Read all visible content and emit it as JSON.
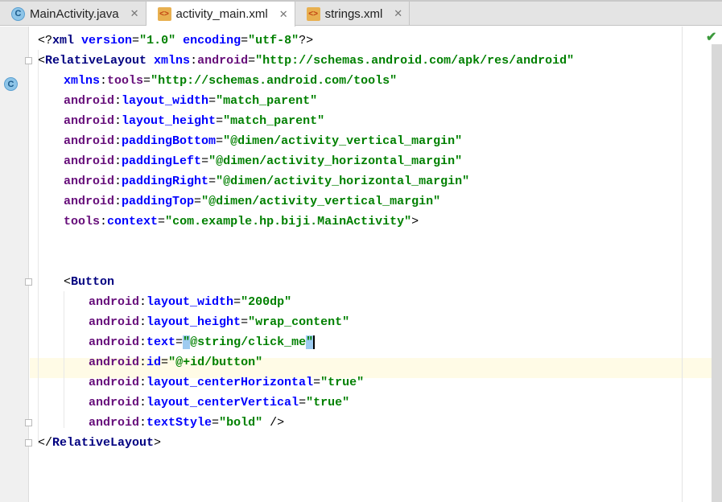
{
  "tabs": [
    {
      "label": "MainActivity.java",
      "icon": "java-class-icon",
      "active": false
    },
    {
      "label": "activity_main.xml",
      "icon": "xml-file-icon",
      "active": true
    },
    {
      "label": "strings.xml",
      "icon": "xml-file-icon",
      "active": false
    }
  ],
  "close_glyph": "✕",
  "status_icon": "✔",
  "lines": [
    {
      "indent": 0,
      "tokens": [
        [
          "pun",
          "<?"
        ],
        [
          "tag",
          "xml "
        ],
        [
          "attr",
          "version"
        ],
        [
          "pun",
          "="
        ],
        [
          "val",
          "\"1.0\" "
        ],
        [
          "attr",
          "encoding"
        ],
        [
          "pun",
          "="
        ],
        [
          "val",
          "\"utf-8\""
        ],
        [
          "pun",
          "?>"
        ]
      ]
    },
    {
      "indent": 0,
      "tokens": [
        [
          "pun",
          "<"
        ],
        [
          "tag",
          "RelativeLayout "
        ],
        [
          "attr",
          "xmlns"
        ],
        [
          "pun",
          ":"
        ],
        [
          "ns",
          "android"
        ],
        [
          "pun",
          "="
        ],
        [
          "val",
          "\"http://schemas.android.com/apk/res/android\""
        ]
      ]
    },
    {
      "indent": 1,
      "tokens": [
        [
          "attr",
          "xmlns"
        ],
        [
          "pun",
          ":"
        ],
        [
          "ns",
          "tools"
        ],
        [
          "pun",
          "="
        ],
        [
          "val",
          "\"http://schemas.android.com/tools\""
        ]
      ]
    },
    {
      "indent": 1,
      "tokens": [
        [
          "ns",
          "android"
        ],
        [
          "pun",
          ":"
        ],
        [
          "attr",
          "layout_width"
        ],
        [
          "pun",
          "="
        ],
        [
          "val",
          "\"match_parent\""
        ]
      ]
    },
    {
      "indent": 1,
      "tokens": [
        [
          "ns",
          "android"
        ],
        [
          "pun",
          ":"
        ],
        [
          "attr",
          "layout_height"
        ],
        [
          "pun",
          "="
        ],
        [
          "val",
          "\"match_parent\""
        ]
      ]
    },
    {
      "indent": 1,
      "tokens": [
        [
          "ns",
          "android"
        ],
        [
          "pun",
          ":"
        ],
        [
          "attr",
          "paddingBottom"
        ],
        [
          "pun",
          "="
        ],
        [
          "val",
          "\"@dimen/activity_vertical_margin\""
        ]
      ]
    },
    {
      "indent": 1,
      "tokens": [
        [
          "ns",
          "android"
        ],
        [
          "pun",
          ":"
        ],
        [
          "attr",
          "paddingLeft"
        ],
        [
          "pun",
          "="
        ],
        [
          "val",
          "\"@dimen/activity_horizontal_margin\""
        ]
      ]
    },
    {
      "indent": 1,
      "tokens": [
        [
          "ns",
          "android"
        ],
        [
          "pun",
          ":"
        ],
        [
          "attr",
          "paddingRight"
        ],
        [
          "pun",
          "="
        ],
        [
          "val",
          "\"@dimen/activity_horizontal_margin\""
        ]
      ]
    },
    {
      "indent": 1,
      "tokens": [
        [
          "ns",
          "android"
        ],
        [
          "pun",
          ":"
        ],
        [
          "attr",
          "paddingTop"
        ],
        [
          "pun",
          "="
        ],
        [
          "val",
          "\"@dimen/activity_vertical_margin\""
        ]
      ]
    },
    {
      "indent": 1,
      "tokens": [
        [
          "ns",
          "tools"
        ],
        [
          "pun",
          ":"
        ],
        [
          "attr",
          "context"
        ],
        [
          "pun",
          "="
        ],
        [
          "val",
          "\"com.example.hp.biji.MainActivity\""
        ],
        [
          "pun",
          ">"
        ]
      ]
    },
    {
      "indent": 0,
      "tokens": []
    },
    {
      "indent": 0,
      "tokens": []
    },
    {
      "indent": 1,
      "tokens": [
        [
          "pun",
          "<"
        ],
        [
          "tag",
          "Button"
        ]
      ]
    },
    {
      "indent": 2,
      "tokens": [
        [
          "ns",
          "android"
        ],
        [
          "pun",
          ":"
        ],
        [
          "attr",
          "layout_width"
        ],
        [
          "pun",
          "="
        ],
        [
          "val",
          "\"200dp\""
        ]
      ]
    },
    {
      "indent": 2,
      "tokens": [
        [
          "ns",
          "android"
        ],
        [
          "pun",
          ":"
        ],
        [
          "attr",
          "layout_height"
        ],
        [
          "pun",
          "="
        ],
        [
          "val",
          "\"wrap_content\""
        ]
      ]
    },
    {
      "indent": 2,
      "tokens": [
        [
          "ns",
          "android"
        ],
        [
          "pun",
          ":"
        ],
        [
          "attr",
          "text"
        ],
        [
          "pun",
          "="
        ],
        [
          "val hl",
          "\""
        ],
        [
          "val",
          "@string/click_me"
        ],
        [
          "val hl",
          "\""
        ]
      ]
    },
    {
      "indent": 2,
      "tokens": [
        [
          "ns",
          "android"
        ],
        [
          "pun",
          ":"
        ],
        [
          "attr",
          "id"
        ],
        [
          "pun",
          "="
        ],
        [
          "val",
          "\"@+id/button\""
        ]
      ]
    },
    {
      "indent": 2,
      "tokens": [
        [
          "ns",
          "android"
        ],
        [
          "pun",
          ":"
        ],
        [
          "attr",
          "layout_centerHorizontal"
        ],
        [
          "pun",
          "="
        ],
        [
          "val",
          "\"true\""
        ]
      ]
    },
    {
      "indent": 2,
      "tokens": [
        [
          "ns",
          "android"
        ],
        [
          "pun",
          ":"
        ],
        [
          "attr",
          "layout_centerVertical"
        ],
        [
          "pun",
          "="
        ],
        [
          "val",
          "\"true\""
        ]
      ]
    },
    {
      "indent": 2,
      "tokens": [
        [
          "ns",
          "android"
        ],
        [
          "pun",
          ":"
        ],
        [
          "attr",
          "textStyle"
        ],
        [
          "pun",
          "="
        ],
        [
          "val",
          "\"bold\" "
        ],
        [
          "pun",
          "/>"
        ]
      ]
    },
    {
      "indent": 0,
      "tokens": [
        [
          "pun",
          "</"
        ],
        [
          "tag",
          "RelativeLayout"
        ],
        [
          "pun",
          ">"
        ]
      ]
    }
  ]
}
